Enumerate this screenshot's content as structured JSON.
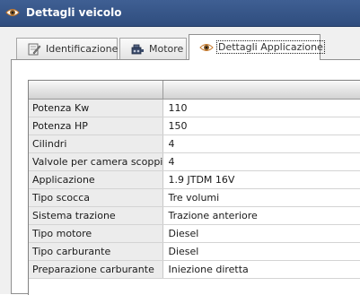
{
  "window": {
    "title": "Dettagli veicolo",
    "title_icon": "eye-icon",
    "background": "#2f4d7e"
  },
  "tabs": [
    {
      "label": "Identificazione",
      "icon": "document-edit-icon",
      "active": false
    },
    {
      "label": "Motore",
      "icon": "engine-icon",
      "active": false
    },
    {
      "label": "Dettagli Applicazione",
      "icon": "eye-icon",
      "active": true
    }
  ],
  "grid": {
    "columns": [
      "",
      ""
    ],
    "rows": [
      {
        "label": "Potenza Kw",
        "value": "110"
      },
      {
        "label": "Potenza HP",
        "value": "150"
      },
      {
        "label": "Cilindri",
        "value": "4"
      },
      {
        "label": "Valvole per camera scoppio",
        "value": "4"
      },
      {
        "label": "Applicazione",
        "value": "1.9 JTDM 16V"
      },
      {
        "label": "Tipo scocca",
        "value": "Tre volumi"
      },
      {
        "label": "Sistema trazione",
        "value": "Trazione anteriore"
      },
      {
        "label": "Tipo motore",
        "value": "Diesel"
      },
      {
        "label": "Tipo carburante",
        "value": "Diesel"
      },
      {
        "label": "Preparazione carburante",
        "value": "Iniezione diretta"
      }
    ]
  }
}
